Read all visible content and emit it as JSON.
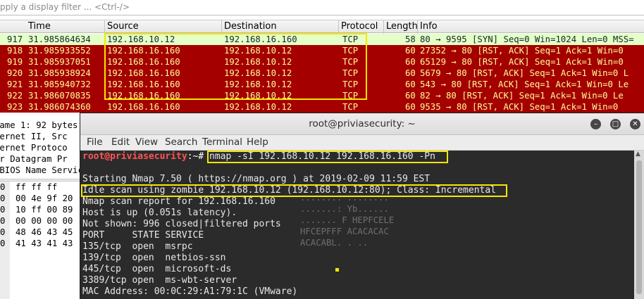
{
  "filter": {
    "placeholder": "pply a display filter ... <Ctrl-/>"
  },
  "columns": [
    "Time",
    "Source",
    "Destination",
    "Protocol",
    "Length",
    "Info"
  ],
  "packets": [
    {
      "no": "917",
      "time": "31.985864634",
      "src": "192.168.10.12",
      "dst": "192.168.16.160",
      "proto": "TCP",
      "len": "58",
      "info": "80 → 9595 [SYN] Seq=0 Win=1024 Len=0 MSS="
    },
    {
      "no": "918",
      "time": "31.985933552",
      "src": "192.168.16.160",
      "dst": "192.168.10.12",
      "proto": "TCP",
      "len": "60",
      "info": "27352 → 80 [RST, ACK] Seq=1 Ack=1 Win=0"
    },
    {
      "no": "919",
      "time": "31.985937051",
      "src": "192.168.16.160",
      "dst": "192.168.10.12",
      "proto": "TCP",
      "len": "60",
      "info": "65129 → 80 [RST, ACK] Seq=1 Ack=1 Win=0"
    },
    {
      "no": "920",
      "time": "31.985938924",
      "src": "192.168.16.160",
      "dst": "192.168.10.12",
      "proto": "TCP",
      "len": "60",
      "info": "5679 → 80 [RST, ACK] Seq=1 Ack=1 Win=0 L"
    },
    {
      "no": "921",
      "time": "31.985940732",
      "src": "192.168.16.160",
      "dst": "192.168.10.12",
      "proto": "TCP",
      "len": "60",
      "info": "543 → 80 [RST, ACK] Seq=1 Ack=1 Win=0 Le"
    },
    {
      "no": "922",
      "time": "31.986070835",
      "src": "192.168.16.160",
      "dst": "192.168.10.12",
      "proto": "TCP",
      "len": "60",
      "info": "82 → 80 [RST, ACK] Seq=1 Ack=1 Win=0 Le"
    },
    {
      "no": "923",
      "time": "31.986074360",
      "src": "192.168.16.160",
      "dst": "192.168.10.12",
      "proto": "TCP",
      "len": "60",
      "info": "9535 → 80 [RST, ACK] Seq=1 Ack=1 Win=0"
    }
  ],
  "details": [
    "rame 1: 92 bytes",
    "hernet II, Src",
    "ternet Protoco",
    "er Datagram Pr",
    "tBIOS Name Service"
  ],
  "bytes": [
    {
      "off": "0",
      "hex": "ff ff ff"
    },
    {
      "off": "0",
      "hex": "00 4e 9f 20"
    },
    {
      "off": "0",
      "hex": "10 ff 00 89"
    },
    {
      "off": "0",
      "hex": "00 00 00 00"
    },
    {
      "off": "0",
      "hex": "48 46 43 45"
    },
    {
      "off": "0",
      "hex": "41 43 41 43"
    }
  ],
  "ghost_ascii": [
    "........ ........",
    ".......: Yb......",
    "....... F HEPFCELE",
    "HFCEPFFF ACACACAC",
    "ACACABL. . .."
  ],
  "terminal": {
    "title": "root@priviasecurity: ~",
    "menu": [
      "File",
      "Edit",
      "View",
      "Search",
      "Terminal",
      "Help"
    ],
    "prompt_user": "root@priviasecurity",
    "prompt_path": ":~# ",
    "command": "nmap -sI 192.168.10.12 192.168.16.160 -Pn",
    "output": [
      "Starting Nmap 7.50 ( https://nmap.org ) at 2019-02-09 11:59 EST",
      "Idle scan using zombie 192.168.10.12 (192.168.10.12:80); Class: Incremental",
      "Nmap scan report for 192.168.16.160",
      "Host is up (0.051s latency).",
      "Not shown: 996 closed|filtered ports",
      "PORT     STATE SERVICE",
      "135/tcp  open  msrpc",
      "139/tcp  open  netbios-ssn",
      "445/tcp  open  microsoft-ds",
      "3389/tcp open  ms-wbt-server",
      "MAC Address: 00:0C:29:A1:79:1C (VMware)"
    ]
  },
  "colors": {
    "rst_bg": "#a40000",
    "rst_fg": "#fffc9c",
    "syn_bg": "#e4ffc7",
    "highlight": "#f7e600"
  }
}
